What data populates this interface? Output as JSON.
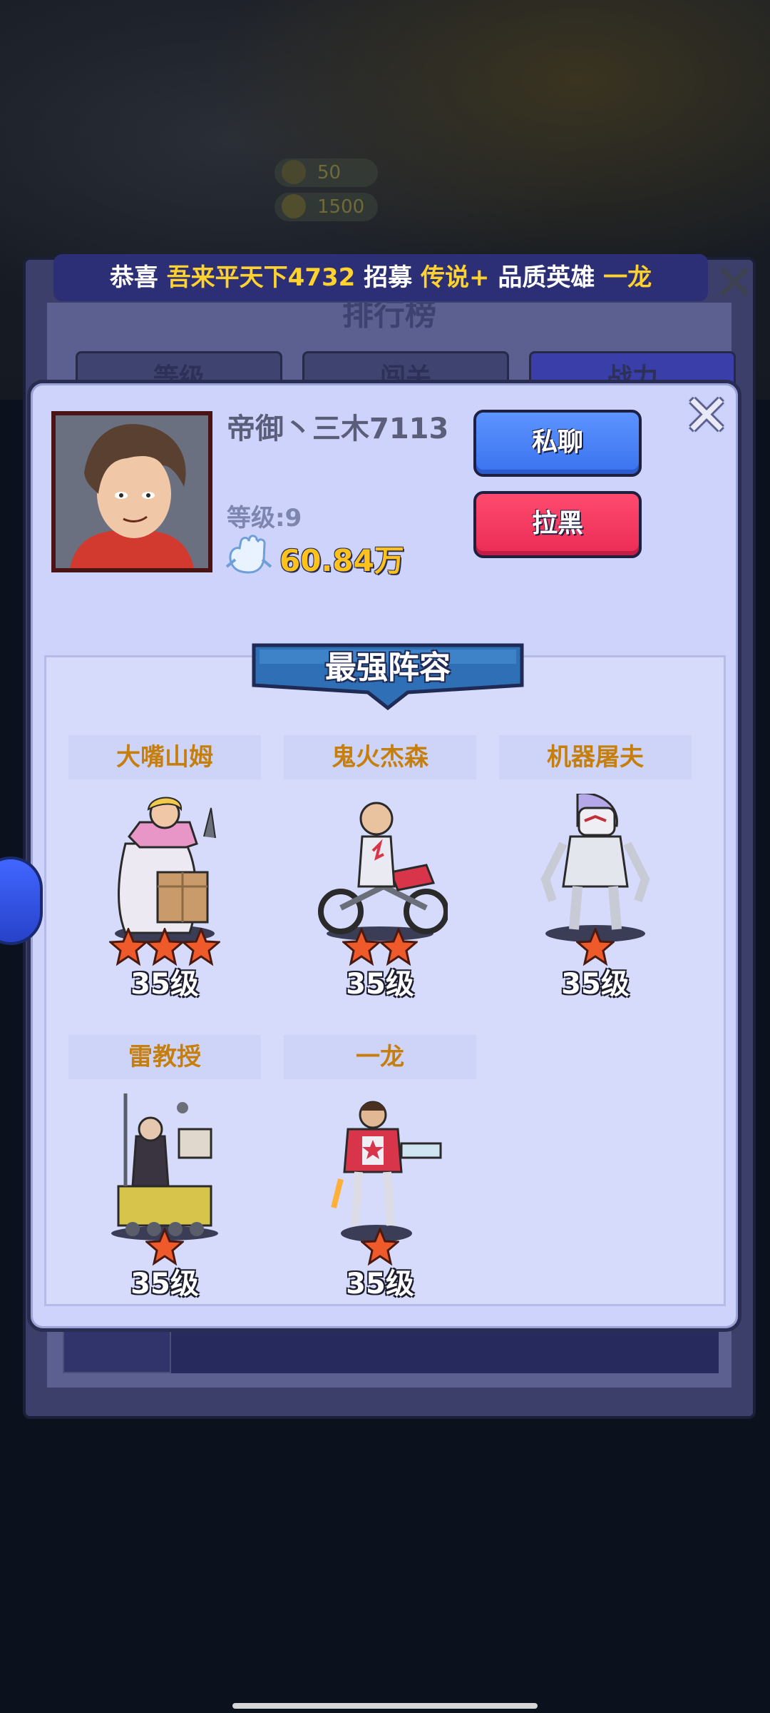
{
  "hud": {
    "stat_value": "50",
    "coin_value": "1500"
  },
  "ranking": {
    "title": "排行榜",
    "tabs": [
      "等级",
      "闯关",
      "战力"
    ]
  },
  "notice": {
    "prefix": "恭喜",
    "player": "吾来平天下4732",
    "action": "招募",
    "quality": "传说+",
    "mid": "品质英雄",
    "hero": "一龙"
  },
  "player": {
    "name": "帝御丶三木7113",
    "level_label": "等级:9",
    "power": "60.84万",
    "chat_button": "私聊",
    "block_button": "拉黑"
  },
  "lineup": {
    "title": "最强阵容",
    "heroes": [
      {
        "name": "大嘴山姆",
        "level": "35级",
        "stars": 3
      },
      {
        "name": "鬼火杰森",
        "level": "35级",
        "stars": 2
      },
      {
        "name": "机器屠夫",
        "level": "35级",
        "stars": 1
      },
      {
        "name": "雷教授",
        "level": "35级",
        "stars": 1
      },
      {
        "name": "一龙",
        "level": "35级",
        "stars": 1
      }
    ]
  },
  "icons": {
    "close": "close-icon",
    "power": "fist-power-icon",
    "star": "star-icon",
    "side": "side-menu-icon"
  },
  "colors": {
    "dialog_bg": "#cdd3fb",
    "chat_button": "#3a72ee",
    "block_button": "#ea2c55",
    "hero_name": "#c67f0c",
    "power_value": "#ffc21c",
    "notice_highlight": "#ffd22e"
  }
}
